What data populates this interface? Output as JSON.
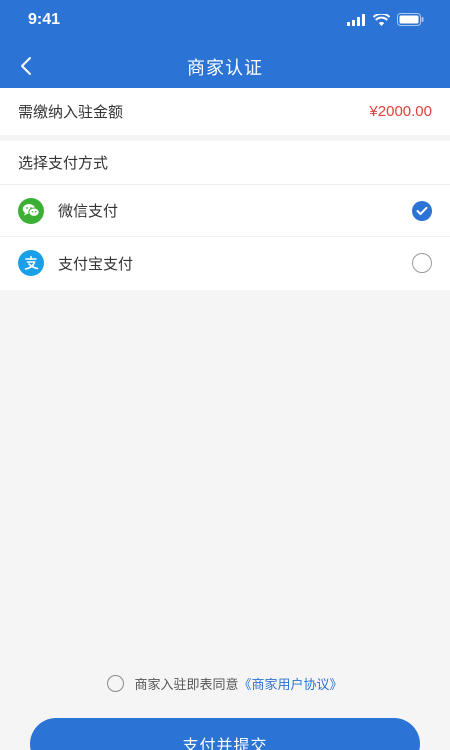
{
  "status_bar": {
    "time": "9:41"
  },
  "nav": {
    "title": "商家认证"
  },
  "amount": {
    "label": "需缴纳入驻金额",
    "value": "¥2000.00"
  },
  "payment": {
    "section_title": "选择支付方式",
    "options": [
      {
        "label": "微信支付",
        "icon": "wechat-pay-icon",
        "selected": true,
        "color": "#3cb034"
      },
      {
        "label": "支付宝支付",
        "icon": "alipay-icon",
        "selected": false,
        "color": "#1aa0e8"
      }
    ]
  },
  "agreement": {
    "text": "商家入驻即表同意",
    "link": "《商家用户协议》"
  },
  "submit": {
    "label": "支付并提交"
  },
  "colors": {
    "primary": "#2b74d6",
    "price": "#e0413a"
  }
}
